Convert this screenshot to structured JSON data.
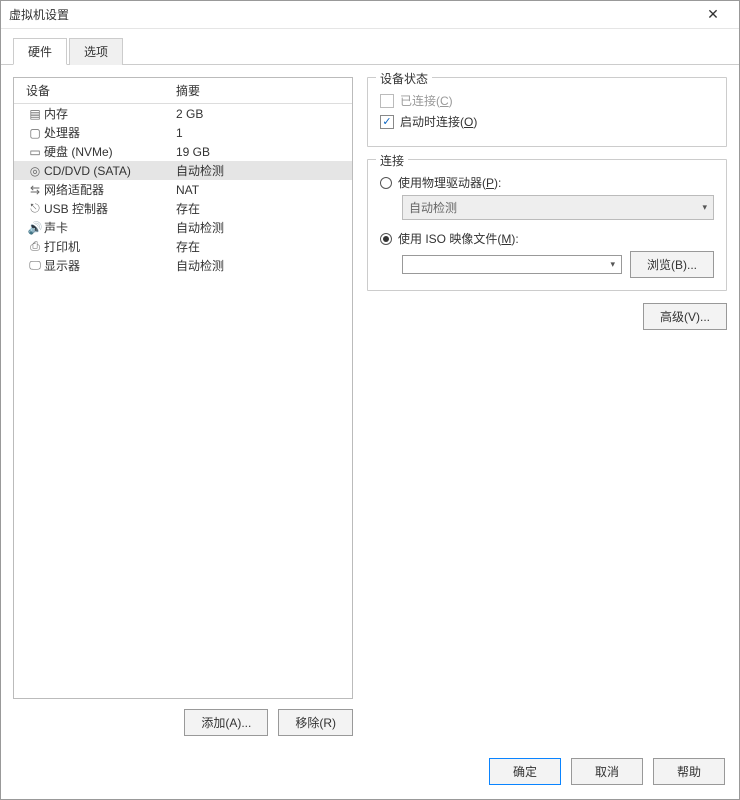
{
  "window": {
    "title": "虚拟机设置"
  },
  "tabs": {
    "hardware": "硬件",
    "options": "选项"
  },
  "device_table": {
    "header_device": "设备",
    "header_summary": "摘要",
    "rows": [
      {
        "icon": "memory-icon",
        "name": "内存",
        "summary": "2 GB"
      },
      {
        "icon": "cpu-icon",
        "name": "处理器",
        "summary": "1"
      },
      {
        "icon": "disk-icon",
        "name": "硬盘 (NVMe)",
        "summary": "19 GB"
      },
      {
        "icon": "cd-icon",
        "name": "CD/DVD (SATA)",
        "summary": "自动检测"
      },
      {
        "icon": "network-icon",
        "name": "网络适配器",
        "summary": "NAT"
      },
      {
        "icon": "usb-icon",
        "name": "USB 控制器",
        "summary": "存在"
      },
      {
        "icon": "sound-icon",
        "name": "声卡",
        "summary": "自动检测"
      },
      {
        "icon": "printer-icon",
        "name": "打印机",
        "summary": "存在"
      },
      {
        "icon": "display-icon",
        "name": "显示器",
        "summary": "自动检测"
      }
    ],
    "selected_index": 3
  },
  "left_buttons": {
    "add": "添加(A)...",
    "remove": "移除(R)"
  },
  "status_group": {
    "legend": "设备状态",
    "connected_label_pre": "已连接(",
    "connected_label_hot": "C",
    "connected_label_post": ")",
    "connected_checked": false,
    "connected_enabled": false,
    "connect_on_label_pre": "启动时连接(",
    "connect_on_label_hot": "O",
    "connect_on_label_post": ")",
    "connect_on_checked": true
  },
  "connection_group": {
    "legend": "连接",
    "physical_label_pre": "使用物理驱动器(",
    "physical_label_hot": "P",
    "physical_label_post": "):",
    "physical_value": "自动检测",
    "iso_label_pre": "使用 ISO 映像文件(",
    "iso_label_hot": "M",
    "iso_label_post": "):",
    "iso_value": "",
    "selected": "iso",
    "browse": "浏览(B)..."
  },
  "advanced": "高级(V)...",
  "footer": {
    "ok": "确定",
    "cancel": "取消",
    "help": "帮助"
  }
}
